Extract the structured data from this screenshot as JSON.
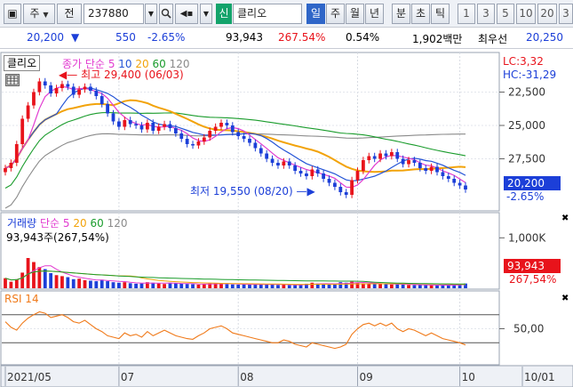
{
  "toolbar": {
    "period_label": "주",
    "prev_label": "전",
    "code": "237880",
    "credit_label": "신",
    "stock_name": "클리오",
    "tabs": [
      "일",
      "주",
      "월",
      "년",
      "분",
      "초",
      "틱",
      "1",
      "3",
      "5",
      "10",
      "20",
      "3"
    ],
    "active_tab": "일"
  },
  "quote": {
    "price": "20,200",
    "direction": "▼",
    "change": "550",
    "change_pct": "-2.65%",
    "volume": "93,943",
    "volume_ratio": "267.54%",
    "turnover": "0.54%",
    "amount": "1,902백만",
    "bid_label": "최우선",
    "bid": "20,250"
  },
  "price_panel": {
    "name_box": "클리오",
    "legend_title": "종가 단순",
    "ma_periods": [
      "5",
      "10",
      "20",
      "60",
      "120"
    ],
    "high_note": "최고 29,400 (06/03)",
    "low_note": "최저 19,550 (08/20)",
    "lc": "LC:3,32",
    "hc": "HC:-31,29",
    "axis_labels": [
      "27,500",
      "25,000",
      "22,500"
    ],
    "last_price": "20,200",
    "last_pct": "-2.65%"
  },
  "volume_panel": {
    "legend_title": "거래량",
    "legend_ma": "단순",
    "ma_periods": [
      "5",
      "20",
      "60",
      "120"
    ],
    "summary": "93,943주(267,54%)",
    "axis_label": "1,000K",
    "last_volume": "93,943",
    "last_pct": "267,54%"
  },
  "rsi_panel": {
    "legend": "RSI 14",
    "axis_label": "50,00"
  },
  "time_axis": [
    "2021/05",
    "07",
    "08",
    "09",
    "10",
    "10/01"
  ],
  "colors": {
    "up": "#e8131b",
    "down": "#1c3fd8",
    "ma5": "#e23bd0",
    "ma10": "#2454d6",
    "ma20": "#f2a30a",
    "ma60": "#1a9c2c",
    "ma120": "#8a8a8a",
    "rsi": "#f07a1a",
    "accent": "#2f66c8"
  },
  "chart_data": {
    "type": "candlestick",
    "close": [
      21800,
      22200,
      23600,
      25500,
      26500,
      27500,
      28300,
      28000,
      27400,
      27800,
      28100,
      27900,
      27300,
      27700,
      27900,
      27600,
      27200,
      26600,
      25900,
      25300,
      24900,
      25400,
      25100,
      25000,
      24700,
      25200,
      24600,
      24900,
      25100,
      24800,
      24400,
      24000,
      23600,
      23500,
      23800,
      24100,
      24600,
      24900,
      25200,
      25000,
      24500,
      24200,
      24000,
      23700,
      23300,
      22900,
      22500,
      22200,
      22000,
      22300,
      22000,
      21600,
      21400,
      21200,
      21700,
      21400,
      21000,
      20700,
      20400,
      20000,
      19800,
      20900,
      21600,
      22400,
      22700,
      22500,
      22900,
      22700,
      23000,
      22500,
      22100,
      22400,
      22200,
      21800,
      21600,
      21900,
      21500,
      21200,
      21000,
      20700,
      20500,
      20200
    ],
    "volume_k": [
      200,
      130,
      180,
      310,
      600,
      520,
      420,
      380,
      300,
      260,
      240,
      220,
      180,
      190,
      160,
      150,
      140,
      170,
      140,
      120,
      110,
      120,
      100,
      90,
      95,
      120,
      110,
      95,
      85,
      110,
      100,
      90,
      85,
      80,
      70,
      85,
      95,
      105,
      90,
      80,
      75,
      70,
      80,
      75,
      70,
      80,
      85,
      70,
      65,
      70,
      60,
      65,
      75,
      90,
      110,
      95,
      80,
      75,
      85,
      120,
      110,
      130,
      115,
      95,
      85,
      80,
      90,
      85,
      75,
      80,
      70,
      65,
      60,
      70,
      65,
      60,
      55,
      60,
      70,
      65,
      75,
      94
    ],
    "rsi": [
      60,
      52,
      48,
      58,
      65,
      70,
      74,
      72,
      66,
      68,
      70,
      66,
      60,
      58,
      62,
      56,
      50,
      46,
      40,
      38,
      36,
      44,
      40,
      42,
      38,
      46,
      40,
      44,
      48,
      44,
      40,
      38,
      36,
      35,
      40,
      44,
      50,
      52,
      54,
      50,
      44,
      42,
      40,
      38,
      36,
      34,
      32,
      30,
      30,
      34,
      32,
      28,
      26,
      24,
      30,
      28,
      26,
      24,
      22,
      24,
      28,
      42,
      50,
      56,
      58,
      54,
      58,
      54,
      58,
      50,
      46,
      50,
      48,
      44,
      40,
      44,
      40,
      36,
      34,
      32,
      30,
      27
    ],
    "price_ylim": [
      19000,
      30000
    ],
    "price_ticks": [
      22500,
      25000,
      27500
    ],
    "volume_ylim": [
      0,
      1200
    ],
    "rsi_ylim": [
      0,
      100
    ],
    "rsi_ticks": [
      50
    ],
    "high": {
      "value": 29400,
      "date": "06/03"
    },
    "low": {
      "value": 19550,
      "date": "08/20"
    },
    "ma_legend": [
      "5",
      "10",
      "20",
      "60",
      "120"
    ],
    "x_ticks": [
      "2021/05",
      "07",
      "08",
      "09",
      "10",
      "10/01"
    ]
  }
}
